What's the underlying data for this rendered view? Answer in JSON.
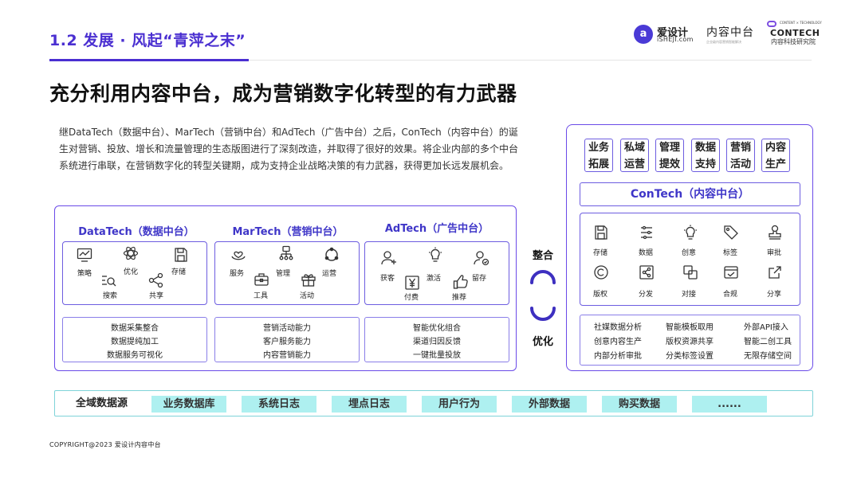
{
  "header": {
    "section_title": "1.2 发展 · 风起“青萍之末”",
    "logos": {
      "ishe_mark": "a",
      "ishe_cn": "爱设计",
      "ishe_en": "iSHEJI.com",
      "zhongtai_cn": "内容中台",
      "zhongtai_sub": "企业级内容营销智能解决",
      "contech_small": "CONTENT × TECHNOLOGY",
      "contech_name": "CONTECH",
      "contech_cn": "内容科技研究院"
    }
  },
  "main_heading": "充分利用内容中台，成为营销数字化转型的有力武器",
  "paragraph": "继DataTech（数据中台）、MarTech（营销中台）和AdTech（广告中台）之后，ConTech（内容中台）的诞生对营销、投放、增长和流量管理的生态版图进行了深刻改造，并取得了很好的效果。将企业内部的多个中台系统进行串联，在营销数字化的转型关键期，成为支持企业战略决策的有力武器，获得更加长远发展机会。",
  "pillars": {
    "datatech": {
      "title": "DataTech（数据中台）",
      "icons": [
        "策略",
        "优化",
        "存储",
        "搜索",
        "共享"
      ],
      "capabilities": [
        "数据采集整合",
        "数据提纯加工",
        "数据服务可视化"
      ]
    },
    "martech": {
      "title": "MarTech（营销中台）",
      "icons": [
        "服务",
        "管理",
        "运营",
        "工具",
        "活动"
      ],
      "capabilities": [
        "营销活动能力",
        "客户服务能力",
        "内容营销能力"
      ]
    },
    "adtech": {
      "title": "AdTech（广告中台）",
      "icons": [
        "获客",
        "激活",
        "留存",
        "付费",
        "推荐"
      ],
      "capabilities": [
        "智能优化组合",
        "渠道归因反馈",
        "一键批量投放"
      ]
    }
  },
  "middle": {
    "top_word": "整合",
    "bottom_word": "优化"
  },
  "contech": {
    "categories": [
      [
        "业务",
        "拓展"
      ],
      [
        "私域",
        "运营"
      ],
      [
        "管理",
        "提效"
      ],
      [
        "数据",
        "支持"
      ],
      [
        "营销",
        "活动"
      ],
      [
        "内容",
        "生产"
      ]
    ],
    "title": "ConTech（内容中台）",
    "functions_row1": [
      "存储",
      "数据",
      "创意",
      "标签",
      "审批"
    ],
    "functions_row2": [
      "版权",
      "分发",
      "对接",
      "合规",
      "分享"
    ],
    "features": [
      "社媒数据分析",
      "智能模板取用",
      "外部API接入",
      "创意内容生产",
      "版权资源共享",
      "智能二创工具",
      "内部分析审批",
      "分类标签设置",
      "无限存储空间"
    ]
  },
  "data_sources": {
    "label": "全域数据源",
    "items": [
      "业务数据库",
      "系统日志",
      "埋点日志",
      "用户行为",
      "外部数据",
      "购买数据",
      "......"
    ]
  },
  "copyright": "COPYRIGHT@2023 爱设计内容中台",
  "colors": {
    "accent": "#4a2fd1",
    "border": "#6a4ae8",
    "chip": "#aef0f0",
    "chip_border": "#7fd3d8"
  }
}
